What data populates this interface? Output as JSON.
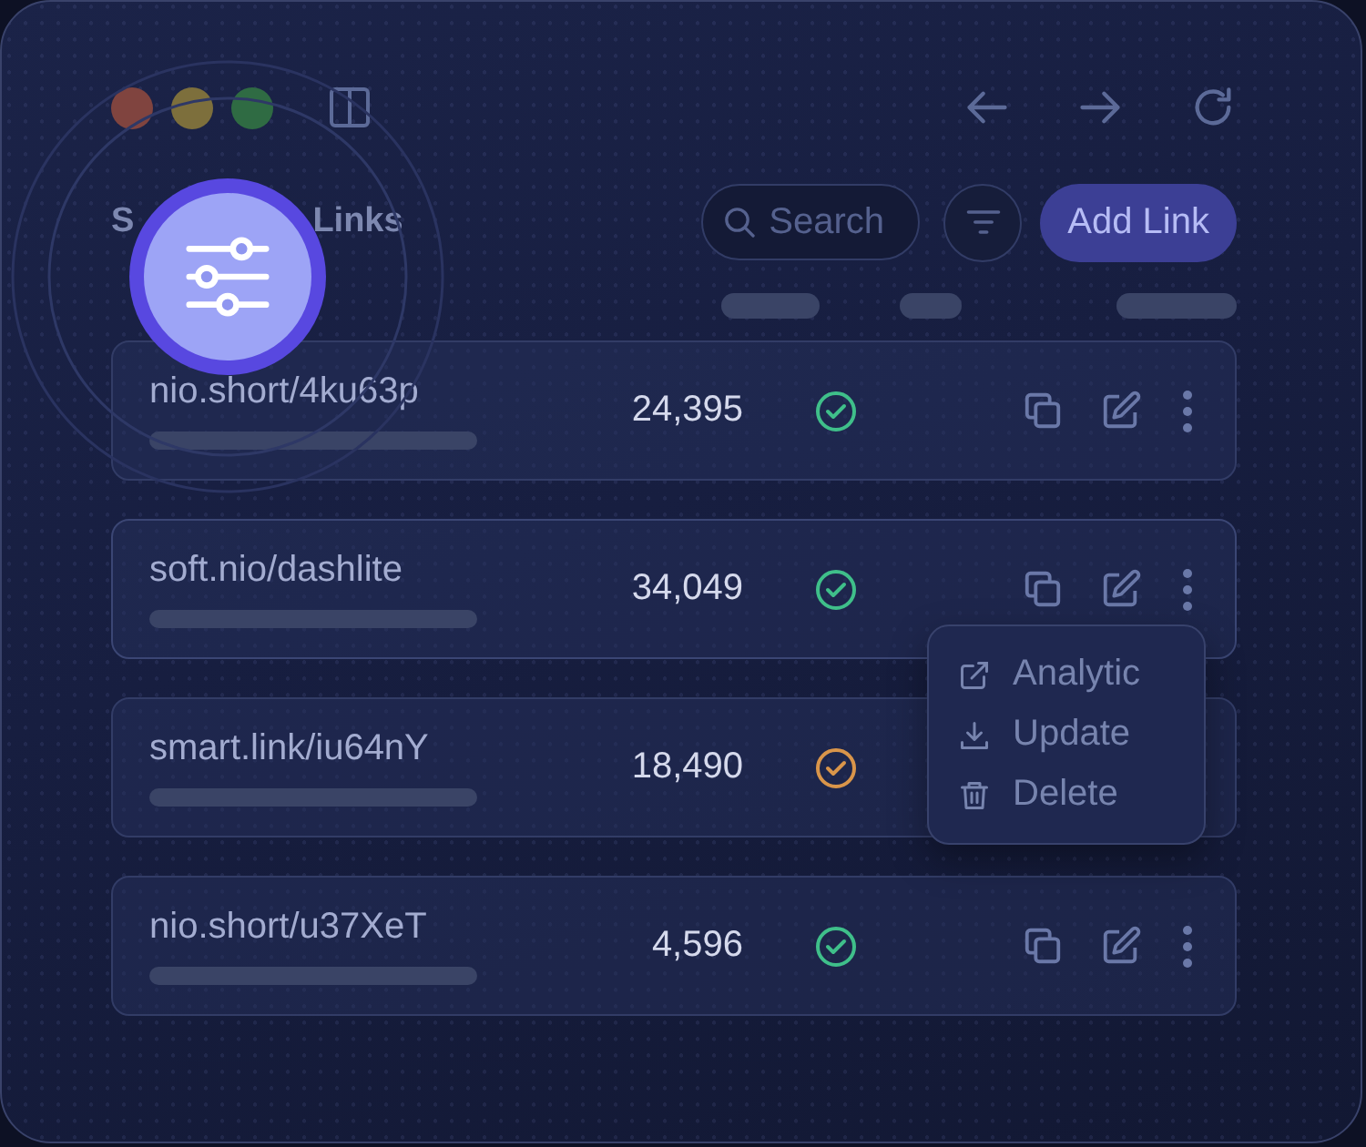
{
  "title_parts": [
    "S",
    "Links"
  ],
  "search": {
    "placeholder": "Search"
  },
  "add_button": "Add Link",
  "rows": [
    {
      "url": "nio.short/4ku63p",
      "count": "24,395",
      "color": "#3fbf8a",
      "menu_open": false
    },
    {
      "url": "soft.nio/dashlite",
      "count": "34,049",
      "color": "#3fbf8a",
      "menu_open": true
    },
    {
      "url": "smart.link/iu64nY",
      "count": "18,490",
      "color": "#d9954a",
      "menu_open": false
    },
    {
      "url": "nio.short/u37XeT",
      "count": "4,596",
      "color": "#3fbf8a",
      "menu_open": false
    }
  ],
  "menu": {
    "items": [
      {
        "kind": "external",
        "label": "Analytic"
      },
      {
        "kind": "download",
        "label": "Update"
      },
      {
        "kind": "trash",
        "label": "Delete"
      }
    ]
  }
}
